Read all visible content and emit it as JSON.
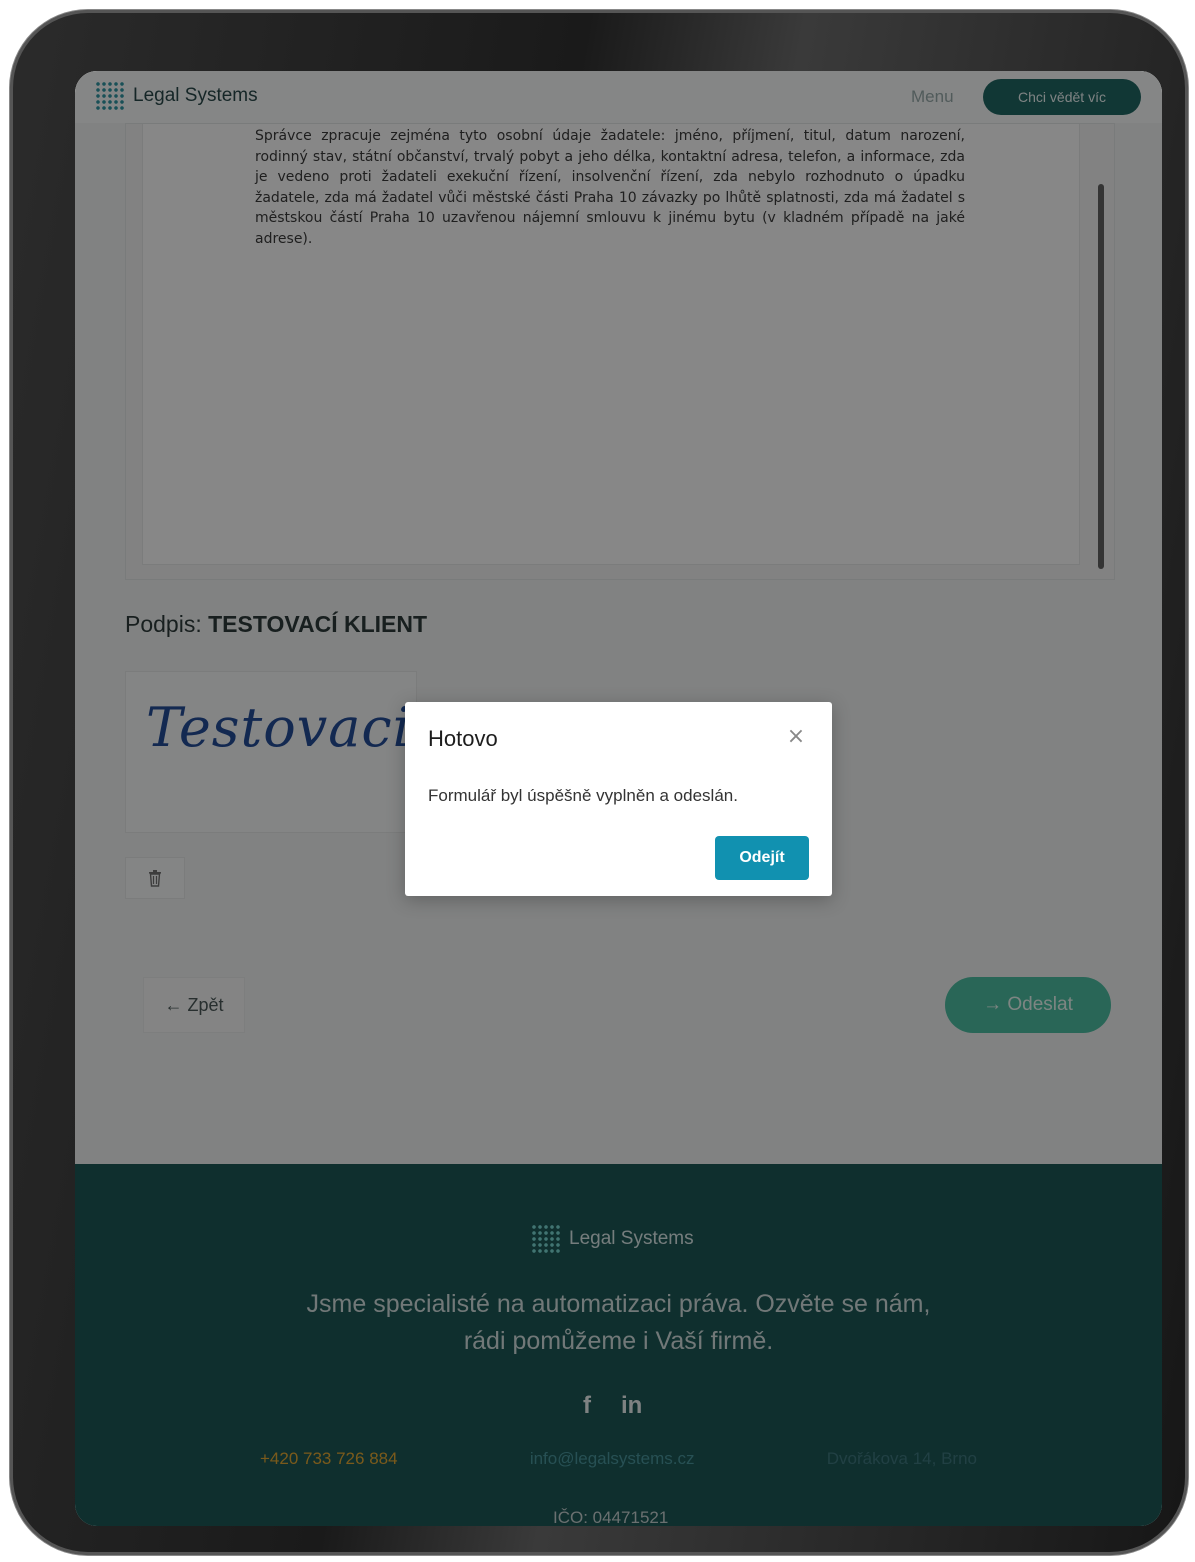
{
  "header": {
    "brand": "Legal Systems",
    "menu_label": "Menu",
    "cta_label": "Chci vědět víc"
  },
  "document": {
    "text": "Správce zpracuje zejména tyto osobní údaje žadatele: jméno, příjmení, titul, datum narození, rodinný stav, státní občanství, trvalý pobyt a jeho délka, kontaktní adresa, telefon, a informace, zda je vedeno proti žadateli exekuční řízení, insolvenční řízení, zda nebylo rozhodnuto o úpadku žadatele, zda má žadatel vůči městské části Praha 10 závazky po lhůtě splatnosti, zda má žadatel s městskou částí Praha 10 uzavřenou nájemní smlouvu k jinému bytu (v kladném případě na jaké adrese)."
  },
  "signature": {
    "label": "Podpis:",
    "name": "TESTOVACÍ KLIENT",
    "handwritten": "Testovaci K"
  },
  "nav": {
    "back_label": "← Zpět",
    "send_label": "→ Odeslat"
  },
  "footer": {
    "brand": "Legal Systems",
    "tagline_line1": "Jsme specialisté na automatizaci práva. Ozvěte se nám,",
    "tagline_line2": "rádi pomůžeme i Vaší firmě.",
    "social_facebook": "f",
    "social_linkedin": "in",
    "phone": "+420 733 726 884",
    "email": "info@legalsystems.cz",
    "address": "Dvořákova 14, Brno",
    "ico": "IČO: 04471521"
  },
  "modal": {
    "title": "Hotovo",
    "close_glyph": "×",
    "message": "Formulář byl úspěšně vyplněn a odeslán.",
    "button_label": "Odejít"
  },
  "colors": {
    "brand_teal": "#0f5a57",
    "send_green": "#3fb89a",
    "modal_button": "#1191b0",
    "footer_bg": "#0b4a49",
    "phone_orange": "#e0a023"
  }
}
